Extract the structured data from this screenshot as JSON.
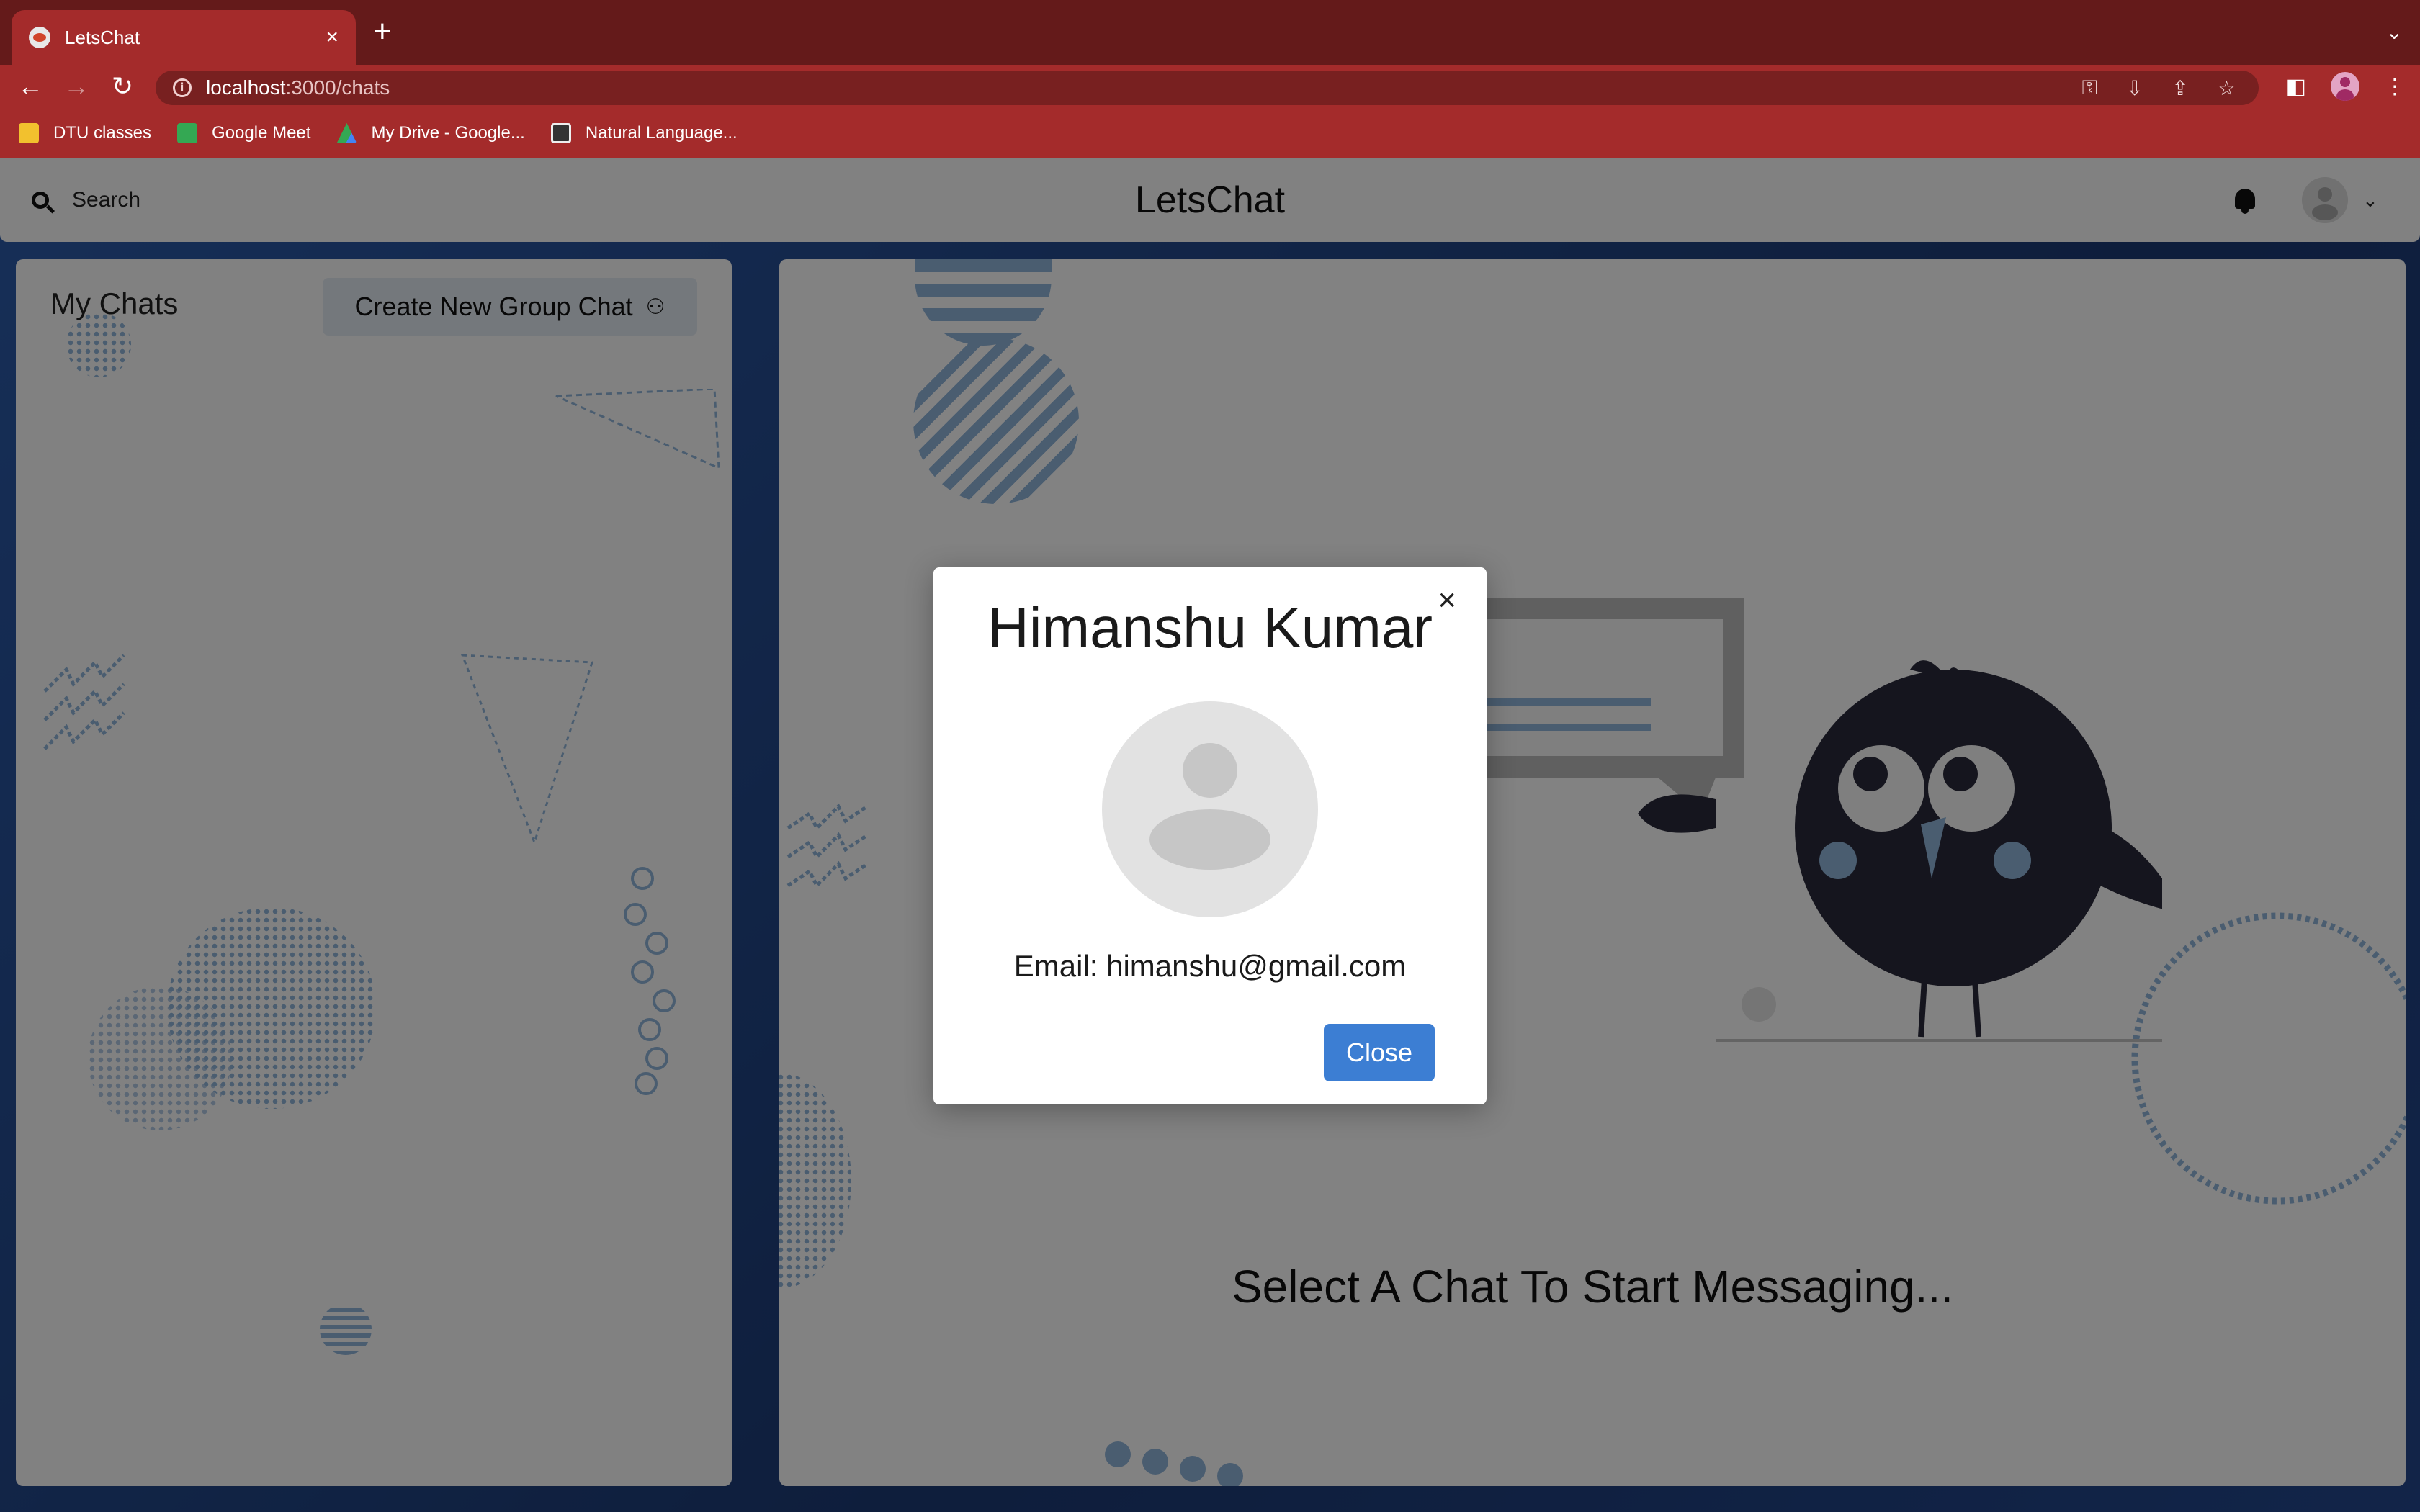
{
  "browser": {
    "tab_title": "LetsChat",
    "tab_close": "×",
    "new_tab": "+",
    "url_host": "localhost",
    "url_path": ":3000/chats",
    "bookmarks": [
      {
        "label": "DTU classes",
        "color": "#f2c12e"
      },
      {
        "label": "Google Meet",
        "color": "#34a853"
      },
      {
        "label": "My Drive - Google...",
        "color": "#4285f4"
      },
      {
        "label": "Natural Language...",
        "color": "#e8e8e8"
      }
    ]
  },
  "header": {
    "search_label": "Search",
    "app_name": "LetsChat"
  },
  "sidebar": {
    "title": "My Chats",
    "create_group_label": "Create New Group Chat"
  },
  "main": {
    "placeholder": "Select A Chat To Start Messaging..."
  },
  "profile_modal": {
    "name": "Himanshu Kumar",
    "email": "Email: himanshu@gmail.com",
    "close_label": "Close",
    "close_icon": "×"
  },
  "colors": {
    "tab_active": "#a42b2b",
    "tab_bar": "#641a1a",
    "accent_button": "#3c7ed3",
    "background": "#1f3f77"
  }
}
